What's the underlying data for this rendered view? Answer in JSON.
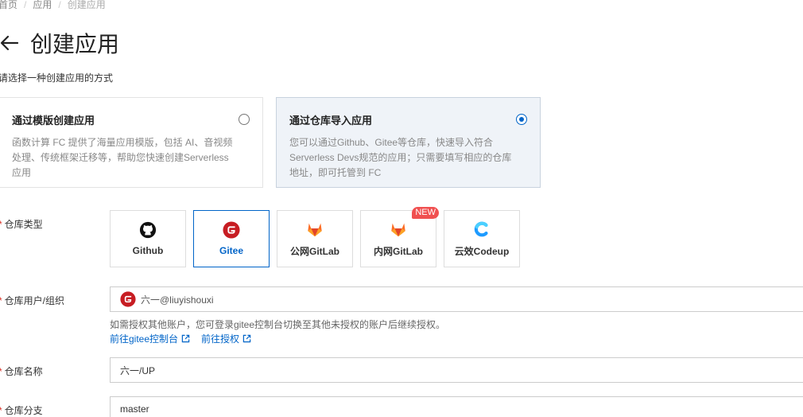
{
  "breadcrumb": {
    "home": "首页",
    "apps": "应用",
    "current": "创建应用"
  },
  "page": {
    "title": "创建应用"
  },
  "method": {
    "label": "请选择一种创建应用的方式",
    "options": [
      {
        "title": "通过模版创建应用",
        "desc": "函数计算 FC 提供了海量应用模版，包括 AI、音视频处理、传统框架迁移等，帮助您快速创建Serverless 应用",
        "selected": false
      },
      {
        "title": "通过仓库导入应用",
        "desc": "您可以通过Github、Gitee等仓库，快速导入符合Serverless Devs规范的应用；只需要填写相应的仓库地址，即可托管到 FC",
        "selected": true
      }
    ]
  },
  "repo_type": {
    "label": "仓库类型",
    "required_mark": "*",
    "badge": "NEW",
    "options": [
      {
        "label": "Github",
        "icon": "github-icon",
        "active": false
      },
      {
        "label": "Gitee",
        "icon": "gitee-icon",
        "active": true
      },
      {
        "label": "公网GitLab",
        "icon": "gitlab-icon",
        "active": false
      },
      {
        "label": "内网GitLab",
        "icon": "gitlab-icon",
        "active": false
      },
      {
        "label": "云效Codeup",
        "icon": "codeup-icon",
        "active": false
      }
    ]
  },
  "repo_user": {
    "label": "仓库用户/组织",
    "value": "六一@liuyishouxi",
    "hint": "如需授权其他账户，您可登录gitee控制台切换至其他未授权的账户后继续授权。",
    "link_console": "前往gitee控制台",
    "link_auth": "前往授权"
  },
  "repo_name": {
    "label": "仓库名称",
    "value": "六一/UP"
  },
  "repo_branch": {
    "label": "仓库分支",
    "value": "master"
  },
  "colors": {
    "accent": "#0064c8",
    "required": "#d93026",
    "gitee": "#c71d23",
    "gitlab": "#e24329",
    "new_badge": "#f05050"
  }
}
